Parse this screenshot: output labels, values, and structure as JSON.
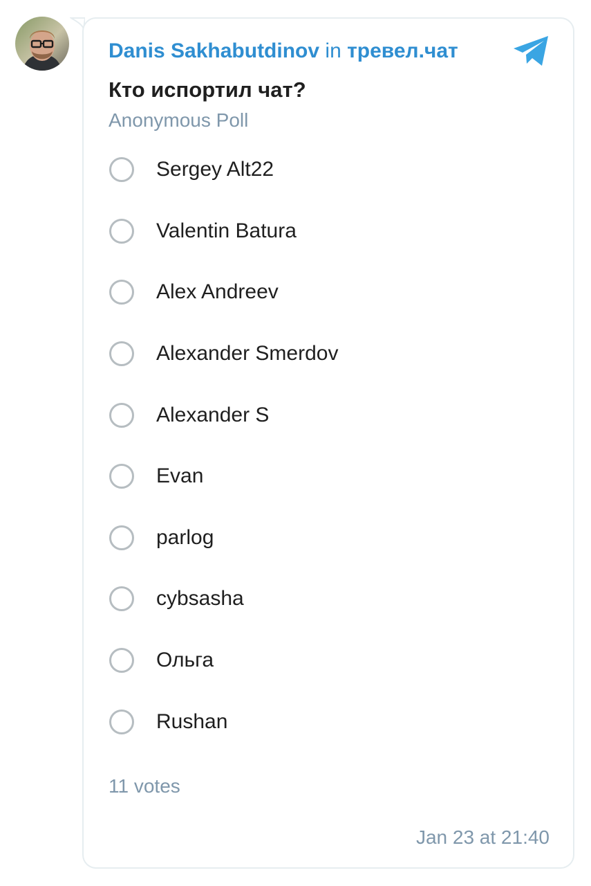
{
  "message": {
    "author": "Danis Sakhabutdinov",
    "in_word": "in",
    "chat_name": "тревел.чат",
    "accent_color": "#2f8ed1",
    "icons": {
      "avatar": "user-photo",
      "share": "telegram-paper-plane-icon"
    }
  },
  "poll": {
    "question": "Кто испортил чат?",
    "type_label": "Anonymous Poll",
    "options": [
      "Sergey Alt22",
      "Valentin Batura",
      "Alex Andreev",
      "Alexander Smerdov",
      "Alexander S",
      "Evan",
      "parlog",
      "cybsasha",
      "Ольга",
      "Rushan"
    ],
    "votes_label": "11 votes",
    "selected_option": null
  },
  "timestamp": "Jan 23 at 21:40"
}
